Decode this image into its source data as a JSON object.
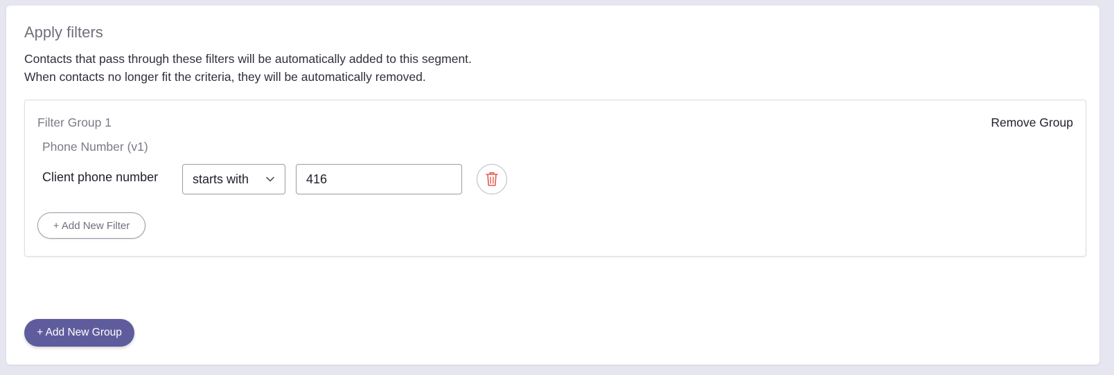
{
  "section": {
    "title": "Apply filters",
    "description_line1": "Contacts that pass through these filters will be automatically added to this segment.",
    "description_line2": "When contacts no longer fit the criteria, they will be automatically removed."
  },
  "filter_group": {
    "title": "Filter Group 1",
    "remove_label": "Remove Group",
    "filter": {
      "category": "Phone Number (v1)",
      "field_label": "Client phone number",
      "operator_value": "starts with",
      "value": "416",
      "delete_icon": "trash-icon"
    },
    "add_filter_label": "+ Add New Filter"
  },
  "add_group_label": "+ Add New Group",
  "colors": {
    "accent": "#5f5c9e",
    "danger": "#e05a4f",
    "background": "#e6e6f1"
  }
}
